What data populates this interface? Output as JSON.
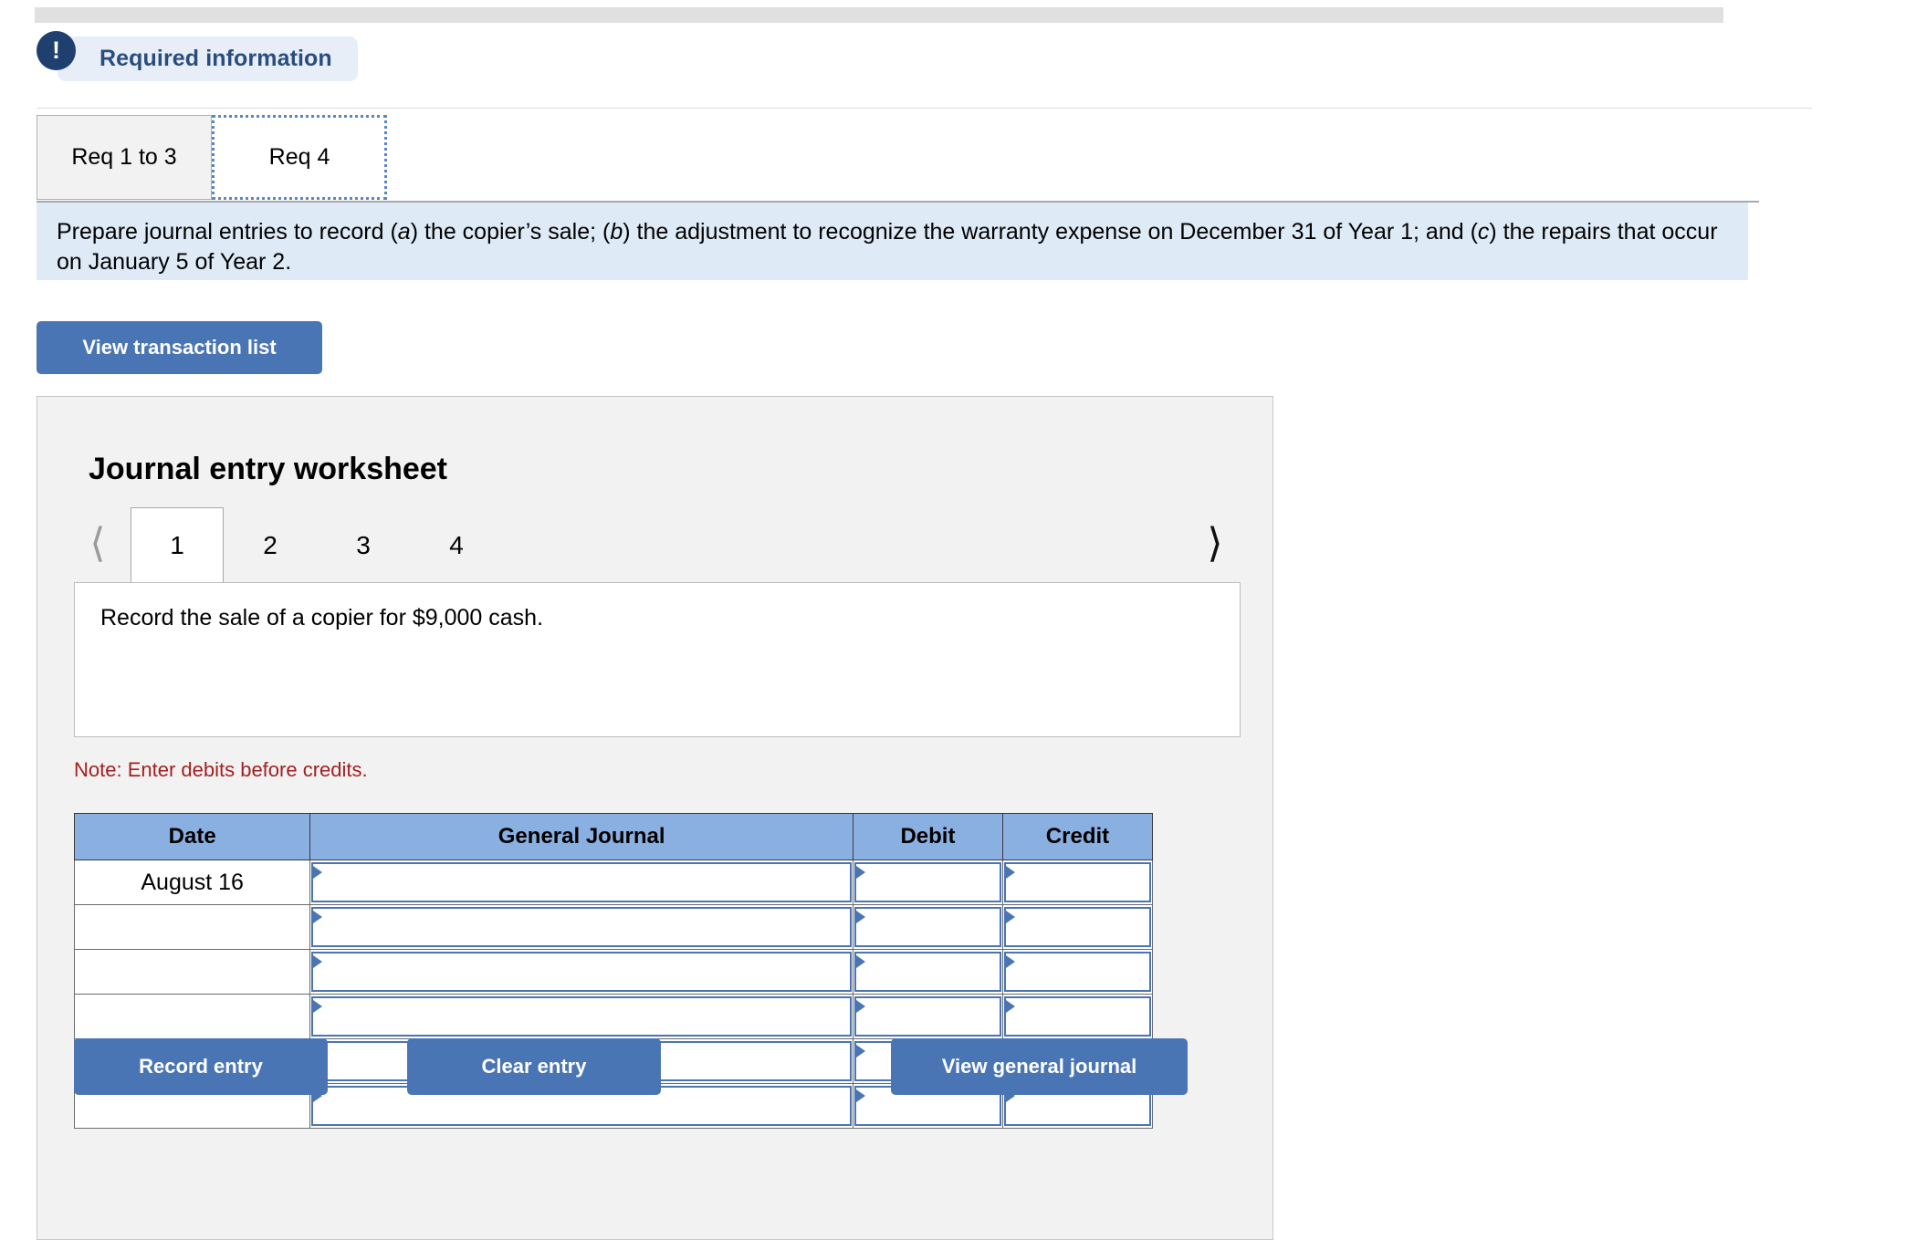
{
  "banner": {
    "icon": "exclamation-icon",
    "label": "Required information"
  },
  "req_tabs": [
    {
      "label": "Req 1 to 3",
      "active": false
    },
    {
      "label": "Req 4",
      "active": true
    }
  ],
  "instruction": {
    "part1": "Prepare journal entries to record (",
    "a": "a",
    "part2": ") the copier’s sale; (",
    "b": "b",
    "part3": ") the adjustment to recognize the warranty expense on December 31 of Year 1; and (",
    "c": "c",
    "part4": ") the repairs that occur on January 5 of Year 2."
  },
  "toolbar": {
    "view_transaction_list": "View transaction list"
  },
  "worksheet": {
    "title": "Journal entry worksheet",
    "pager": {
      "prev_icon": "chevron-left-icon",
      "next_icon": "chevron-right-icon",
      "pages": [
        "1",
        "2",
        "3",
        "4"
      ],
      "active_page": "1"
    },
    "description": "Record the sale of a copier for $9,000 cash.",
    "note": "Note: Enter debits before credits.",
    "table": {
      "headers": [
        "Date",
        "General Journal",
        "Debit",
        "Credit"
      ],
      "rows": [
        {
          "date": "August 16",
          "general_journal": "",
          "debit": "",
          "credit": ""
        },
        {
          "date": "",
          "general_journal": "",
          "debit": "",
          "credit": ""
        },
        {
          "date": "",
          "general_journal": "",
          "debit": "",
          "credit": ""
        },
        {
          "date": "",
          "general_journal": "",
          "debit": "",
          "credit": ""
        },
        {
          "date": "",
          "general_journal": "",
          "debit": "",
          "credit": ""
        },
        {
          "date": "",
          "general_journal": "",
          "debit": "",
          "credit": ""
        }
      ]
    },
    "buttons": {
      "record_entry": "Record entry",
      "clear_entry": "Clear entry",
      "view_general_journal": "View general journal"
    }
  },
  "colors": {
    "accent_blue": "#4a75b5",
    "banner_blue": "#1f3f6e",
    "instruction_bg": "#deeaf6",
    "table_header": "#8ab0e2",
    "note_red": "#a32020"
  }
}
